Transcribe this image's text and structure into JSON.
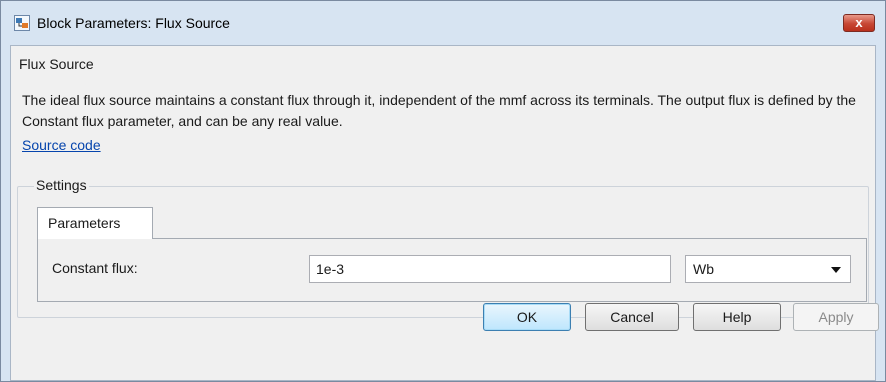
{
  "window": {
    "title": "Block Parameters: Flux Source",
    "close_symbol": "x"
  },
  "block": {
    "group_title": "Flux Source",
    "description": "The ideal flux source maintains a constant flux through it, independent of the mmf across its terminals. The output flux is defined by the Constant flux parameter, and can be any real value.",
    "source_link": "Source code"
  },
  "settings": {
    "group_title": "Settings",
    "tabs": [
      {
        "label": "Parameters",
        "selected": true
      }
    ],
    "parameters": [
      {
        "label": "Constant flux:",
        "value": "1e-3",
        "unit": "Wb"
      }
    ]
  },
  "buttons": {
    "ok": "OK",
    "cancel": "Cancel",
    "help": "Help",
    "apply": "Apply"
  },
  "icons": {
    "app": "simulink-block-icon",
    "close": "close-icon",
    "dropdown": "chevron-down-icon"
  },
  "colors": {
    "title_bar": "#d7e4f2",
    "close_button": "#c74734",
    "link": "#0645ad",
    "ok_border": "#3c7fb1"
  }
}
